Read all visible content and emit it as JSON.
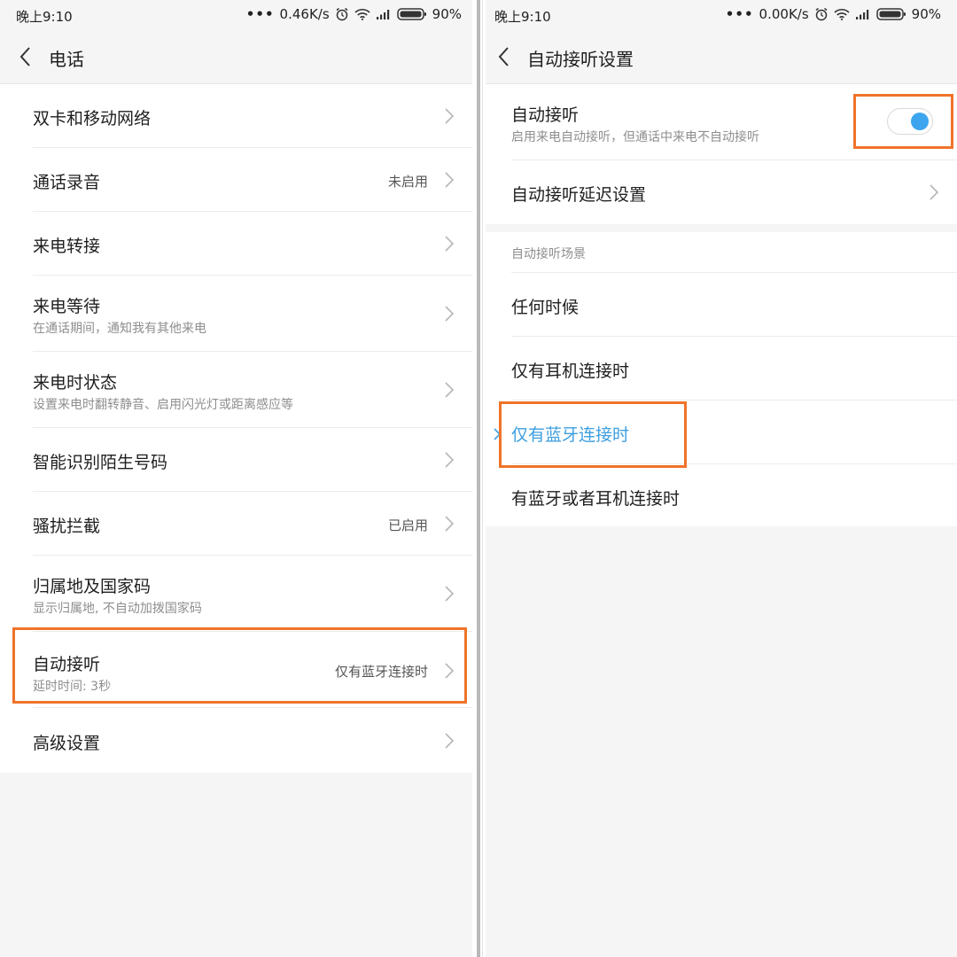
{
  "left": {
    "status": {
      "time": "晚上9:10",
      "speed": "0.46K/s",
      "battery": "90%"
    },
    "title": "电话",
    "items": [
      {
        "title": "双卡和移动网络",
        "subtitle": "",
        "value": ""
      },
      {
        "title": "通话录音",
        "subtitle": "",
        "value": "未启用"
      },
      {
        "title": "来电转接",
        "subtitle": "",
        "value": ""
      },
      {
        "title": "来电等待",
        "subtitle": "在通话期间，通知我有其他来电",
        "value": ""
      },
      {
        "title": "来电时状态",
        "subtitle": "设置来电时翻转静音、启用闪光灯或距离感应等",
        "value": ""
      },
      {
        "title": "智能识别陌生号码",
        "subtitle": "",
        "value": ""
      },
      {
        "title": "骚扰拦截",
        "subtitle": "",
        "value": "已启用"
      },
      {
        "title": "归属地及国家码",
        "subtitle": "显示归属地, 不自动加拨国家码",
        "value": ""
      },
      {
        "title": "自动接听",
        "subtitle": "延时时间: 3秒",
        "value": "仅有蓝牙连接时"
      },
      {
        "title": "高级设置",
        "subtitle": "",
        "value": ""
      }
    ]
  },
  "right": {
    "status": {
      "time": "晚上9:10",
      "speed": "0.00K/s",
      "battery": "90%"
    },
    "title": "自动接听设置",
    "auto_answer": {
      "title": "自动接听",
      "subtitle": "启用来电自动接听，但通话中来电不自动接听",
      "enabled": true
    },
    "delay_setting": {
      "title": "自动接听延迟设置"
    },
    "scenario_header": "自动接听场景",
    "scenarios": [
      {
        "label": "任何时候",
        "selected": false
      },
      {
        "label": "仅有耳机连接时",
        "selected": false
      },
      {
        "label": "仅有蓝牙连接时",
        "selected": true
      },
      {
        "label": "有蓝牙或者耳机连接时",
        "selected": false
      }
    ]
  },
  "colors": {
    "highlight": "#f0732a",
    "accent": "#3da5ef",
    "selected_text": "#3d9fe0"
  },
  "icons": [
    "alarm-icon",
    "wifi-icon",
    "signal-icon",
    "battery-icon",
    "back-icon",
    "chevron-right-icon"
  ]
}
